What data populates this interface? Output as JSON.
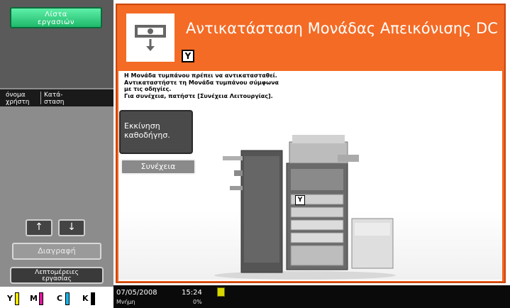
{
  "sidebar": {
    "job_list_label": "Λίστα\nεργασιών",
    "column_user": "όνομα\nχρήστη",
    "column_status": "Κατά-\nσταση",
    "up_arrow": "↑",
    "down_arrow": "↓",
    "delete_label": "Διαγραφή",
    "job_details_label": "Λεπτομέρειες\nεργασίας"
  },
  "toner": [
    {
      "letter": "Y",
      "color": "#f5e600"
    },
    {
      "letter": "M",
      "color": "#e0169a"
    },
    {
      "letter": "C",
      "color": "#18b4e8"
    },
    {
      "letter": "K",
      "color": "#000000"
    }
  ],
  "header": {
    "title": "Αντικατάσταση Μονάδας Απεικόνισης DC",
    "unit_letter": "Y",
    "accent_color": "#f2641e"
  },
  "message": {
    "line1": "Η Μονάδα τυμπάνου πρέπει να αντικατασταθεί.",
    "line2": "Αντικαταστήστε τη Μονάδα τυμπάνου σύμφωνα",
    "line3": "με τις οδηγίες.",
    "line4": "Για συνέχεια, πατήστε [Συνέχεια Λειτουργίας]."
  },
  "buttons": {
    "start_guide": "Εκκίνηση\nκαθοδήγησ.",
    "continue": "Συνέχεια"
  },
  "illustration": {
    "part_label": "Y"
  },
  "status_bar": {
    "date": "07/05/2008",
    "time": "15:24",
    "memory_label": "Μνήμη",
    "memory_value": "0%"
  }
}
